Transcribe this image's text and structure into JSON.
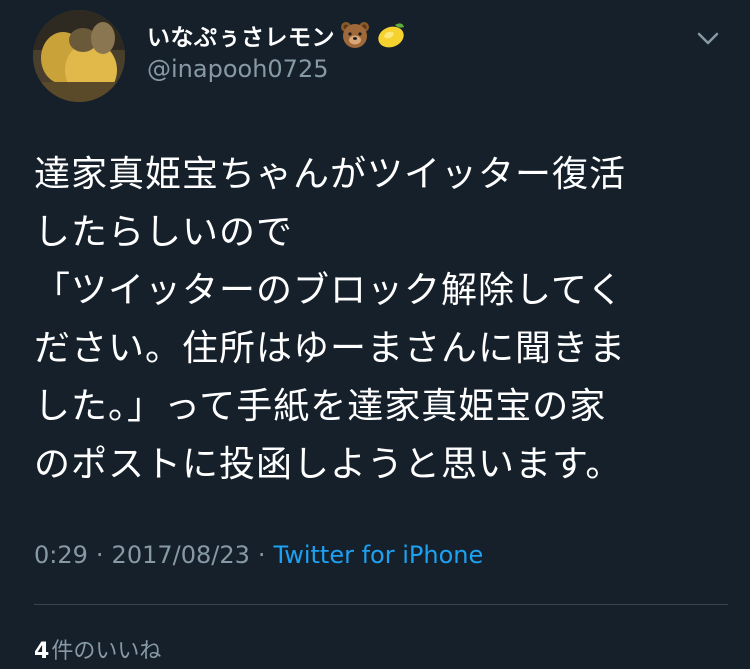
{
  "colors": {
    "background": "#15202b",
    "primary_text": "#ffffff",
    "secondary_text": "#8899a6",
    "link": "#1da1f2",
    "divider": "#38444d"
  },
  "tweet": {
    "author": {
      "display_name": "いなぷぅさレモン",
      "emoji": [
        "bear-face-emoji",
        "lemon-emoji"
      ],
      "handle": "@inapooh0725"
    },
    "text": "達家真姫宝ちゃんがツイッター復活\nしたらしいので\n「ツイッターのブロック解除してく\nださい。住所はゆーまさんに聞きま\nした。」って手紙を達家真姫宝の家\nのポストに投函しようと思います。",
    "meta": {
      "time": "0:29",
      "separator": "·",
      "date": "2017/08/23",
      "source": "Twitter for iPhone"
    },
    "likes": {
      "count": "4",
      "label": "件のいいね"
    }
  }
}
